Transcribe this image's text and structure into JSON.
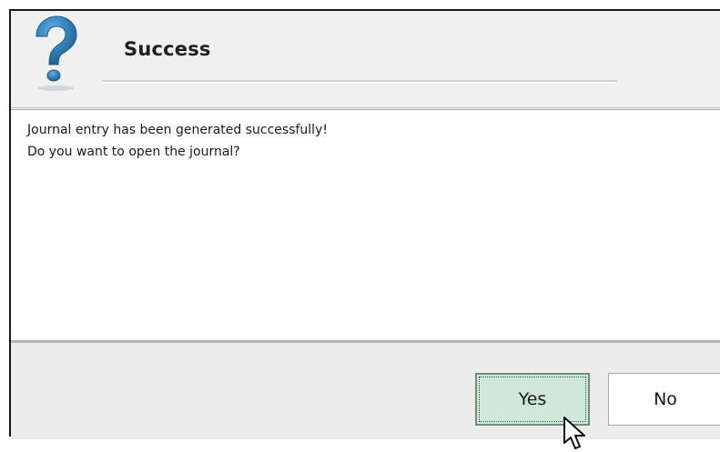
{
  "dialog": {
    "title": "Success",
    "icon": "question-icon",
    "message_lines": [
      "Journal entry has been generated successfully!",
      "Do you want to open the journal?"
    ],
    "buttons": {
      "yes_label": "Yes",
      "no_label": "No"
    }
  },
  "colors": {
    "icon_blue": "#2f7fb8",
    "yes_button_bg": "#cfe8d8",
    "dialog_bg": "#f0f0f0"
  }
}
